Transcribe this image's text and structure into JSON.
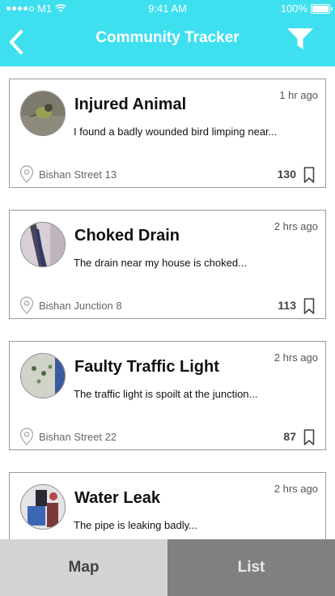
{
  "status": {
    "carrier": "M1",
    "time": "9:41 AM",
    "battery": "100%"
  },
  "header": {
    "title": "Community Tracker",
    "back_icon": "chevron-left-icon",
    "filter_icon": "funnel-icon"
  },
  "colors": {
    "header": "#3ee0f0",
    "tab_map": "#d4d4d4",
    "tab_list": "#7f8180"
  },
  "reports": [
    {
      "title": "Injured Animal",
      "description": "I found a badly wounded bird limping near...",
      "time": "1 hr ago",
      "location": "Bishan Street 13",
      "count": "130"
    },
    {
      "title": "Choked Drain",
      "description": "The drain near my house is choked...",
      "time": "2 hrs ago",
      "location": "Bishan Junction 8",
      "count": "113"
    },
    {
      "title": "Faulty Traffic Light",
      "description": "The traffic light is spoilt at the junction...",
      "time": "2 hrs ago",
      "location": "Bishan Street 22",
      "count": "87"
    },
    {
      "title": "Water Leak",
      "description": "The pipe is leaking badly...",
      "time": "2 hrs ago",
      "location": "",
      "count": ""
    }
  ],
  "tabs": {
    "map": "Map",
    "list": "List",
    "active": "list"
  }
}
